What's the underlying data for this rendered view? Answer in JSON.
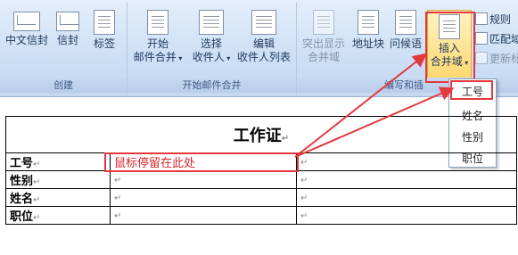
{
  "ribbon": {
    "groups": [
      {
        "label": "创建",
        "buttons": [
          "中文信封",
          "信封",
          "标签"
        ]
      },
      {
        "label": "开始邮件合并",
        "buttons": [
          "开始\n邮件合并",
          "选择\n收件人",
          "编辑\n收件人列表"
        ]
      },
      {
        "label": "编写和插",
        "buttons": [
          "突出显示\n合并域",
          "地址块",
          "问候语",
          "插入\n合并域"
        ]
      }
    ],
    "side_items": [
      "规则",
      "匹配域",
      "更新标"
    ],
    "group_labels": {
      "create": "创建",
      "start": "开始邮件合并",
      "write": "编写和插"
    },
    "btn_cn_env": "中文信封",
    "btn_env": "信封",
    "btn_label": "标签",
    "btn_start_1": "开始",
    "btn_start_2": "邮件合并",
    "btn_select_1": "选择",
    "btn_select_2": "收件人",
    "btn_edit_1": "编辑",
    "btn_edit_2": "收件人列表",
    "btn_highlight_1": "突出显示",
    "btn_highlight_2": "合并域",
    "btn_address": "地址块",
    "btn_greeting": "问候语",
    "btn_insert_1": "插入",
    "btn_insert_2": "合并域"
  },
  "dropdown": {
    "items": [
      "工号",
      "姓名",
      "性别",
      "职位"
    ]
  },
  "document": {
    "title": "工作证",
    "rows": [
      {
        "label": "工号",
        "value": "鼠标停留在此处"
      },
      {
        "label": "性别",
        "value": ""
      },
      {
        "label": "姓名",
        "value": ""
      },
      {
        "label": "职位",
        "value": ""
      }
    ],
    "para_mark": "↵"
  },
  "colors": {
    "highlight": "#e4393c",
    "annotation_text": "#d9262c"
  }
}
